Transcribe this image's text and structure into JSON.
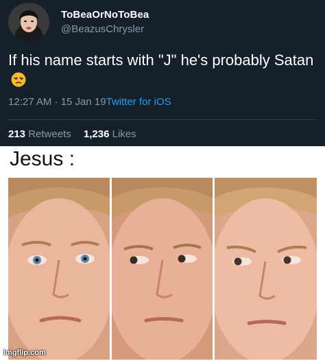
{
  "tweet": {
    "display_name": "ToBeaOrNoToBea",
    "handle": "@BeazusChrysler",
    "text": "If his name starts with \"J\" he's probably Satan",
    "emoji": "unamused-face-emoji",
    "time": "12:27 AM · 15 Jan 19",
    "source": "Twitter for iOS",
    "retweets": "213",
    "retweets_label": "Retweets",
    "likes": "1,236",
    "likes_label": "Likes"
  },
  "meme": {
    "caption": "Jesus :",
    "watermark": "imgflip.com",
    "panels": [
      "face-looking-forward",
      "face-side-eye",
      "face-side-eye-worried"
    ]
  },
  "colors": {
    "tweet_bg": "#15202b",
    "muted_text": "#8899a6",
    "link_blue": "#1da1f2",
    "skin": "#e9b59b",
    "hair": "#c89a6a"
  }
}
